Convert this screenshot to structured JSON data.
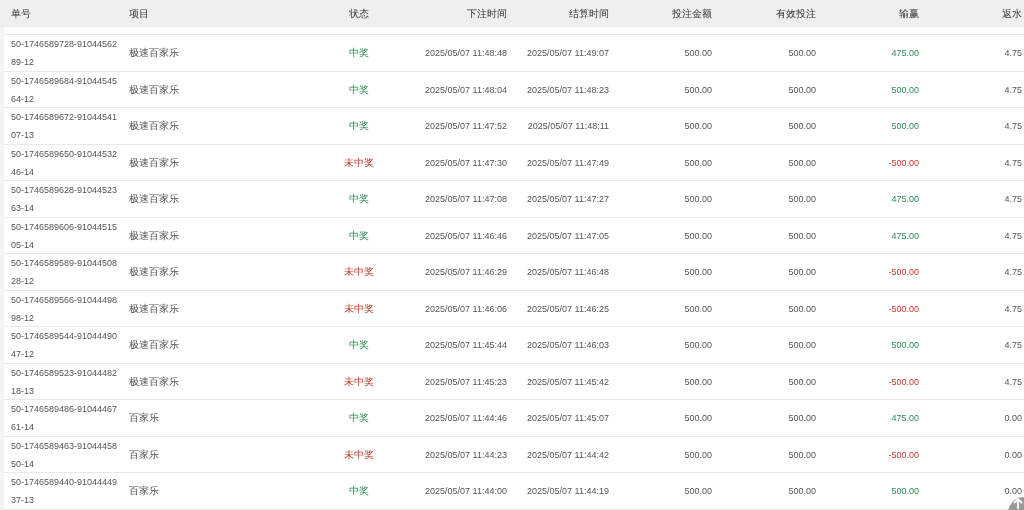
{
  "columns": [
    "单号",
    "项目",
    "状态",
    "下注时间",
    "结算时间",
    "投注金额",
    "有效投注",
    "输赢",
    "返水"
  ],
  "rows": [
    {
      "order_no": "50-1746589728-9104456289-12",
      "game": "极速百家乐",
      "status": "中奖",
      "won": true,
      "bet_time": "2025/05/07 11:48:48",
      "settle_time": "2025/05/07 11:49:07",
      "bet_amount": "500.00",
      "valid_bet": "500.00",
      "profit": "475.00",
      "rebate": "4.75"
    },
    {
      "order_no": "50-1746589684-9104454564-12",
      "game": "极速百家乐",
      "status": "中奖",
      "won": true,
      "bet_time": "2025/05/07 11:48:04",
      "settle_time": "2025/05/07 11:48:23",
      "bet_amount": "500.00",
      "valid_bet": "500.00",
      "profit": "500.00",
      "rebate": "4.75"
    },
    {
      "order_no": "50-1746589672-9104454107-13",
      "game": "极速百家乐",
      "status": "中奖",
      "won": true,
      "bet_time": "2025/05/07 11:47:52",
      "settle_time": "2025/05/07 11:48:11",
      "bet_amount": "500.00",
      "valid_bet": "500.00",
      "profit": "500.00",
      "rebate": "4.75"
    },
    {
      "order_no": "50-1746589650-9104453246-14",
      "game": "极速百家乐",
      "status": "未中奖",
      "won": false,
      "bet_time": "2025/05/07 11:47:30",
      "settle_time": "2025/05/07 11:47:49",
      "bet_amount": "500.00",
      "valid_bet": "500.00",
      "profit": "-500.00",
      "rebate": "4.75"
    },
    {
      "order_no": "50-1746589628-9104452363-14",
      "game": "极速百家乐",
      "status": "中奖",
      "won": true,
      "bet_time": "2025/05/07 11:47:08",
      "settle_time": "2025/05/07 11:47:27",
      "bet_amount": "500.00",
      "valid_bet": "500.00",
      "profit": "475.00",
      "rebate": "4.75"
    },
    {
      "order_no": "50-1746589606-9104451505-14",
      "game": "极速百家乐",
      "status": "中奖",
      "won": true,
      "bet_time": "2025/05/07 11:46:46",
      "settle_time": "2025/05/07 11:47:05",
      "bet_amount": "500.00",
      "valid_bet": "500.00",
      "profit": "475.00",
      "rebate": "4.75"
    },
    {
      "order_no": "50-1746589589-9104450828-12",
      "game": "极速百家乐",
      "status": "未中奖",
      "won": false,
      "bet_time": "2025/05/07 11:46:29",
      "settle_time": "2025/05/07 11:46:48",
      "bet_amount": "500.00",
      "valid_bet": "500.00",
      "profit": "-500.00",
      "rebate": "4.75"
    },
    {
      "order_no": "50-1746589566-9104449898-12",
      "game": "极速百家乐",
      "status": "未中奖",
      "won": false,
      "bet_time": "2025/05/07 11:46:06",
      "settle_time": "2025/05/07 11:46:25",
      "bet_amount": "500.00",
      "valid_bet": "500.00",
      "profit": "-500.00",
      "rebate": "4.75"
    },
    {
      "order_no": "50-1746589544-9104449047-12",
      "game": "极速百家乐",
      "status": "中奖",
      "won": true,
      "bet_time": "2025/05/07 11:45:44",
      "settle_time": "2025/05/07 11:46:03",
      "bet_amount": "500.00",
      "valid_bet": "500.00",
      "profit": "500.00",
      "rebate": "4.75"
    },
    {
      "order_no": "50-1746589523-9104448218-13",
      "game": "极速百家乐",
      "status": "未中奖",
      "won": false,
      "bet_time": "2025/05/07 11:45:23",
      "settle_time": "2025/05/07 11:45:42",
      "bet_amount": "500.00",
      "valid_bet": "500.00",
      "profit": "-500.00",
      "rebate": "4.75"
    },
    {
      "order_no": "50-1746589486-9104446761-14",
      "game": "百家乐",
      "status": "中奖",
      "won": true,
      "bet_time": "2025/05/07 11:44:46",
      "settle_time": "2025/05/07 11:45:07",
      "bet_amount": "500.00",
      "valid_bet": "500.00",
      "profit": "475.00",
      "rebate": "0.00"
    },
    {
      "order_no": "50-1746589463-9104445850-14",
      "game": "百家乐",
      "status": "未中奖",
      "won": false,
      "bet_time": "2025/05/07 11:44:23",
      "settle_time": "2025/05/07 11:44:42",
      "bet_amount": "500.00",
      "valid_bet": "500.00",
      "profit": "-500.00",
      "rebate": "0.00"
    },
    {
      "order_no": "50-1746589440-9104444937-13",
      "game": "百家乐",
      "status": "中奖",
      "won": true,
      "bet_time": "2025/05/07 11:44:00",
      "settle_time": "2025/05/07 11:44:19",
      "bet_amount": "500.00",
      "valid_bet": "500.00",
      "profit": "500.00",
      "rebate": "0.00"
    }
  ]
}
